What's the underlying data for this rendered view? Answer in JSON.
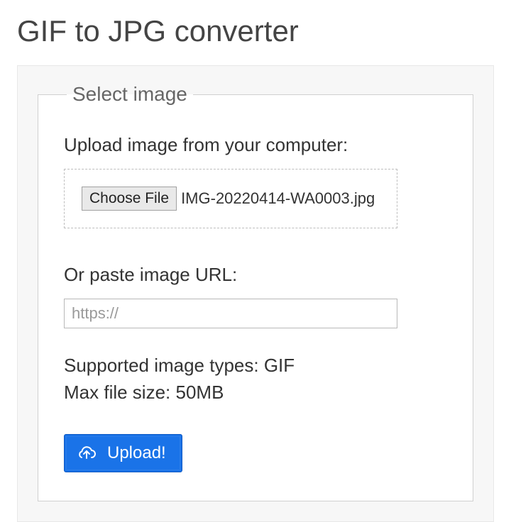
{
  "header": {
    "title": "GIF to JPG converter"
  },
  "select": {
    "legend": "Select image",
    "upload_label": "Upload image from your computer:",
    "choose_button_label": "Choose File",
    "selected_file": "IMG-20220414-WA0003.jpg",
    "url_label": "Or paste image URL:",
    "url_placeholder": "https://",
    "url_value": "",
    "supported_line": "Supported image types: GIF",
    "max_size_line": "Max file size: 50MB",
    "upload_button_label": "Upload!"
  }
}
